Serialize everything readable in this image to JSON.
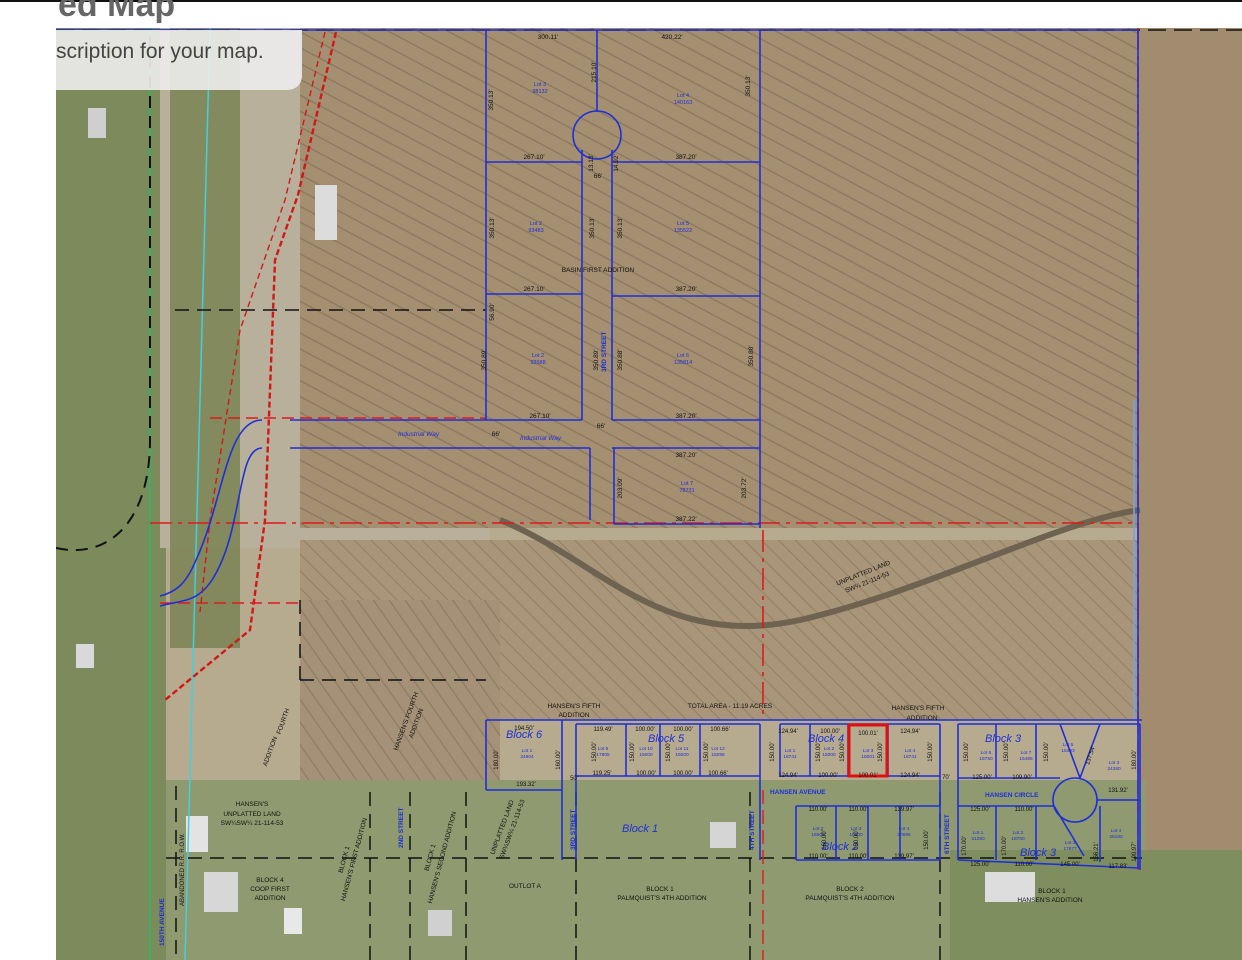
{
  "header": {
    "title": "ed Map",
    "description": "scription for your map."
  },
  "map": {
    "colors": {
      "field": "#a89578",
      "field_dark": "#8e7c62",
      "grass": "#7d8a5a",
      "lot_line": "#1f2fd6",
      "section_line": "#e01a1a",
      "highlight": "#e01010",
      "road_line": "#111111",
      "row_guide": "#20c060"
    },
    "subdivision": {
      "name": "BASIN FIRST ADDITION",
      "lots": [
        {
          "name": "Lot 3",
          "area": "98132"
        },
        {
          "name": "Lot 4",
          "area": "140163"
        },
        {
          "name": "Lot 2",
          "area": "93483"
        },
        {
          "name": "Lot 5",
          "area": "135522"
        },
        {
          "name": "Lot 2",
          "area": "93688"
        },
        {
          "name": "Lot 6",
          "area": "135814"
        },
        {
          "name": "Lot 7",
          "area": "78731"
        }
      ],
      "dims": [
        "300.11'",
        "420.22'",
        "215.10'",
        "350.13'",
        "267.10'",
        "387.20'",
        "13.13'",
        "14.92'",
        "66'",
        "350.13'",
        "350.13'",
        "350.13'",
        "267.10'",
        "387.20'",
        "56.90'",
        "350.89'",
        "350.89'",
        "350.88'",
        "350.88'",
        "267.10'",
        "387.20'",
        "66'",
        "387.20'",
        "203.09'",
        "203.72'",
        "387.22'",
        "66'",
        "350.13'"
      ]
    },
    "streets": {
      "industrial_way_1": "Industrial Way",
      "industrial_way_2": "Industrial Way",
      "third_street_top": "3RD STREET",
      "third_street_bottom": "3RD STREET",
      "second_street": "2ND STREET",
      "fourth_street": "4TH STREET",
      "sixth_street": "6TH STREET",
      "hansen_avenue": "HANSEN AVENUE",
      "hansen_circle": "HANSEN CIRCLE",
      "avenue_150th": "150TH AVENUE",
      "abandoned_row": "ABANDONED R.R. R.O.W."
    },
    "labels": {
      "unplatted_main": "UNPLATTED LAND",
      "unplatted_main_sub": "SW¼ 21-114-53",
      "hansens_fifth_left": "HANSEN'S FIFTH",
      "hansens_fifth_left_2": "ADDITION",
      "total_area": "TOTAL AREA - 11.19 ACRES",
      "hansens_fifth_right": "HANSEN'S FIFTH",
      "hansens_fifth_right_2": "ADDITION",
      "hansens_fourth": "HANSEN'S FOURTH",
      "hansens_fourth_2": "ADDITION",
      "fourth_addition": "FOURTH",
      "fourth_addition_2": "ADDITION",
      "hansens_small": "HANSEN'S",
      "unplatted_left": "UNPLATTED LAND",
      "unplatted_left_sub": "SW¼SW¼ 21-114-53",
      "unplatted_mid": "UNPLATTED LAND",
      "unplatted_mid_sub": "SW¼SW¼ 21-114-53",
      "block1_hansens_first": "BLOCK 1",
      "block1_hansens_first_2": "HANSEN'S FIRST ADDITION",
      "block1_hansens_second": "BLOCK 1",
      "block1_hansens_second_2": "HANSEN'S SECOND ADDITION",
      "block4_coop": "BLOCK 4",
      "block4_coop_2": "COOP FIRST",
      "block4_coop_3": "ADDITION",
      "outlot_a": "OUTLOT A",
      "palmquist_1": "BLOCK 1",
      "palmquist_1_2": "PALMQUIST'S 4TH ADDITION",
      "palmquist_2": "BLOCK 2",
      "palmquist_2_2": "PALMQUIST'S 4TH ADDITION",
      "hansens_add": "BLOCK 1",
      "hansens_add_2": "HANSEN'S ADDITION"
    },
    "blocks": {
      "block6": "Block 6",
      "block5": "Block 5",
      "block4": "Block 4",
      "block3_top": "Block 3",
      "block1": "Block 1",
      "block2": "Block 2",
      "block3_bottom": "Block 3"
    },
    "hansen_dims": [
      "194.50'",
      "119.49'",
      "100.00'",
      "100.00'",
      "100.66'",
      "124.94'",
      "100.00'",
      "100.01'",
      "124.94'",
      "180.00'",
      "160.00'",
      "150.00'",
      "150.00'",
      "150.00'",
      "150.00'",
      "150.00'",
      "150.00'",
      "150.00'",
      "150.00'",
      "150.00'",
      "150.00'",
      "150.00'",
      "150.00'",
      "50'",
      "119.25'",
      "100.00'",
      "100.00'",
      "100.66'",
      "124.94'",
      "100.00'",
      "100.01'",
      "124.94'",
      "70'",
      "125.00'",
      "109.90'",
      "193.32'",
      "110.00'",
      "110.00'",
      "139.97'",
      "125.00'",
      "110.00'",
      "131.92'",
      "110.00'",
      "110.00'",
      "139.97'",
      "125.00'",
      "110.00'",
      "145.00'",
      "117.83'",
      "137.54'",
      "180.00'",
      "160.00'",
      "150.00'",
      "150.00'",
      "170.00'",
      "170.00'",
      "156.21'",
      "190.97'"
    ],
    "hansen_lots": [
      {
        "name": "Lot 1",
        "area": "34904"
      },
      {
        "name": "Lot 9",
        "area": "17805"
      },
      {
        "name": "Lot 10",
        "area": "15000"
      },
      {
        "name": "Lot 11",
        "area": "15000"
      },
      {
        "name": "Lot 12",
        "area": "15098"
      },
      {
        "name": "Lot 1",
        "area": "18741"
      },
      {
        "name": "Lot 2",
        "area": "15000"
      },
      {
        "name": "Lot 3",
        "area": "15001"
      },
      {
        "name": "Lot 4",
        "area": "18741"
      },
      {
        "name": "Lot 6",
        "area": "18750"
      },
      {
        "name": "Lot 7",
        "area": "16485"
      },
      {
        "name": "Lot 5",
        "area": "15493"
      },
      {
        "name": "Lot 3",
        "area": "24380"
      },
      {
        "name": "Lot 2",
        "area": "16500"
      },
      {
        "name": "Lot 3",
        "area": "16500"
      },
      {
        "name": "Lot 4",
        "area": "20996"
      },
      {
        "name": "Lot 1",
        "area": "21250"
      },
      {
        "name": "Lot 2",
        "area": "18700"
      },
      {
        "name": "Lot 3",
        "area": "17877"
      },
      {
        "name": "Lot 4",
        "area": "28180"
      }
    ]
  }
}
